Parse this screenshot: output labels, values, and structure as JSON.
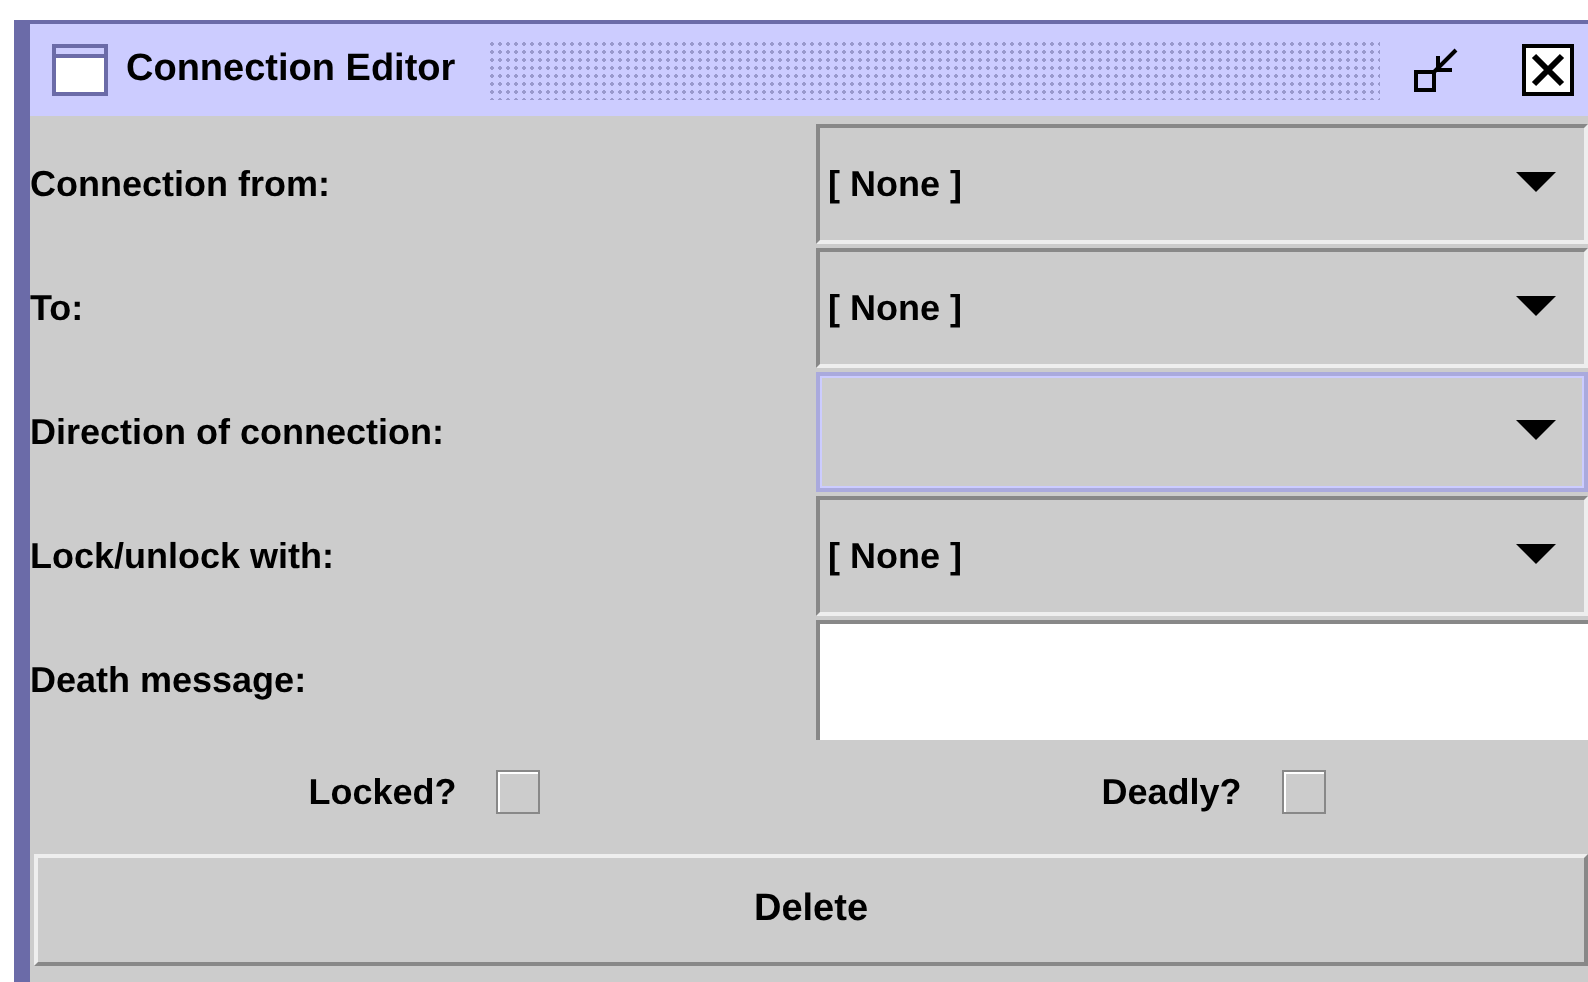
{
  "window": {
    "title": "Connection Editor"
  },
  "rows": [
    {
      "kind": "combo",
      "label": "Connection from:",
      "value": "[ None ]",
      "focused": false
    },
    {
      "kind": "combo",
      "label": "To:",
      "value": "[ None ]",
      "focused": false
    },
    {
      "kind": "combo",
      "label": "Direction of connection:",
      "focused": true
    },
    {
      "kind": "combo",
      "label": "Lock/unlock with:",
      "value": "[ None ]",
      "focused": false
    },
    {
      "kind": "text",
      "label": "Death message:"
    }
  ],
  "checkboxes": [
    {
      "label": "Locked?",
      "checked": false
    },
    {
      "label": "Deadly?",
      "checked": false
    }
  ],
  "button": "Delete"
}
